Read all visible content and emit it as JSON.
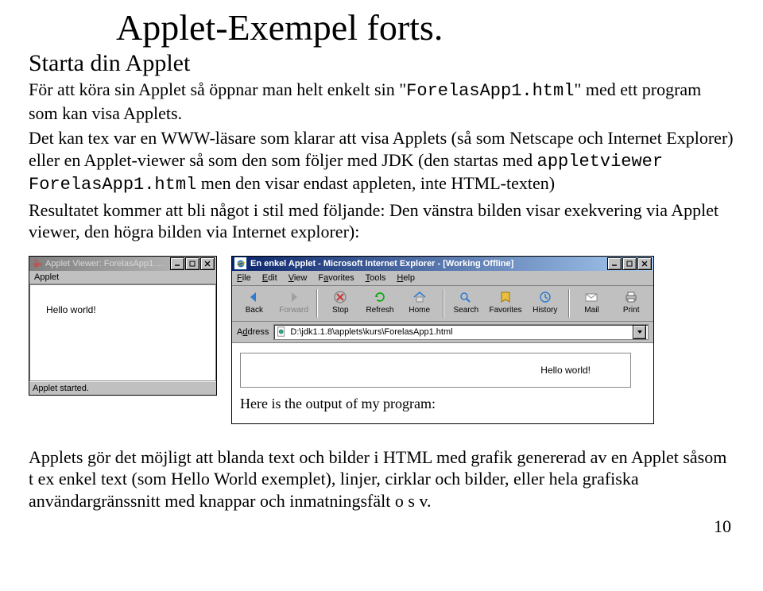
{
  "doc": {
    "title": "Applet-Exempel forts.",
    "subtitle": "Starta din Applet",
    "para1_pre": "För att köra sin Applet så öppnar man helt enkelt sin \"",
    "para1_file": "ForelasApp1.html",
    "para1_post": "\" med ett program som kan visa Applets.",
    "para2_a": "Det kan tex var en WWW-läsare som klarar att visa Applets (så som Netscape och Internet Explorer) eller en Applet-viewer så som den som följer med JDK (den startas med ",
    "para2_cmd": "appletviewer ForelasApp1.html",
    "para2_b": " men den visar endast appleten, inte HTML-texten)",
    "para3": "Resultatet kommer att bli något i stil med följande: Den vänstra bilden visar exekvering via Applet viewer, den högra bilden via Internet explorer):",
    "para4": "Applets gör det möjligt att blanda text och bilder i HTML med grafik genererad av en Applet såsom t ex enkel text (som Hello World exemplet), linjer, cirklar och bilder, eller hela grafiska användargränssnitt med knappar och inmatningsfält o s v.",
    "page_number": "10"
  },
  "av": {
    "title": "Applet Viewer: ForelasApp1....",
    "menu": "Applet",
    "content": "Hello world!",
    "status": "Applet started."
  },
  "ie": {
    "title": "En enkel Applet - Microsoft Internet Explorer - [Working Offline]",
    "menu": {
      "file": "File",
      "edit": "Edit",
      "view": "View",
      "fav": "Favorites",
      "tools": "Tools",
      "help": "Help"
    },
    "toolbar": {
      "back": "Back",
      "forward": "Forward",
      "stop": "Stop",
      "refresh": "Refresh",
      "home": "Home",
      "search": "Search",
      "favorites": "Favorites",
      "history": "History",
      "mail": "Mail",
      "print": "Print"
    },
    "addr_label": "Address",
    "addr_value": "D:\\jdk1.1.8\\applets\\kurs\\ForelasApp1.html",
    "applet_text": "Hello world!",
    "page_text": "Here is the output of my program:"
  }
}
